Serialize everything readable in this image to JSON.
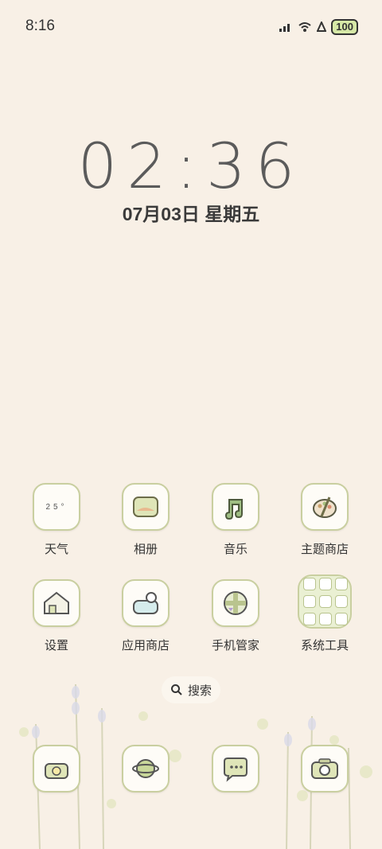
{
  "status": {
    "time": "8:16",
    "battery": "100",
    "icons": [
      "signal-bars-icon",
      "wifi-icon",
      "alarm-icon"
    ]
  },
  "lockscreen": {
    "clock": "02:36",
    "date": "07月03日 星期五"
  },
  "apps": [
    {
      "label": "天气",
      "icon": "weather-icon",
      "weather_text": "25°"
    },
    {
      "label": "相册",
      "icon": "gallery-icon"
    },
    {
      "label": "音乐",
      "icon": "music-icon"
    },
    {
      "label": "主题商店",
      "icon": "theme-store-icon"
    },
    {
      "label": "设置",
      "icon": "settings-icon"
    },
    {
      "label": "应用商店",
      "icon": "app-store-icon"
    },
    {
      "label": "手机管家",
      "icon": "phone-manager-icon"
    },
    {
      "label": "系统工具",
      "icon": "system-tools-folder-icon"
    }
  ],
  "search": {
    "label": "搜索"
  },
  "dock": [
    {
      "icon": "phone-icon"
    },
    {
      "icon": "browser-icon"
    },
    {
      "icon": "messages-icon"
    },
    {
      "icon": "camera-icon"
    }
  ],
  "colors": {
    "background": "#f8f0e6",
    "accent": "#c9cfa0",
    "battery_fill": "#d7e9a7"
  }
}
